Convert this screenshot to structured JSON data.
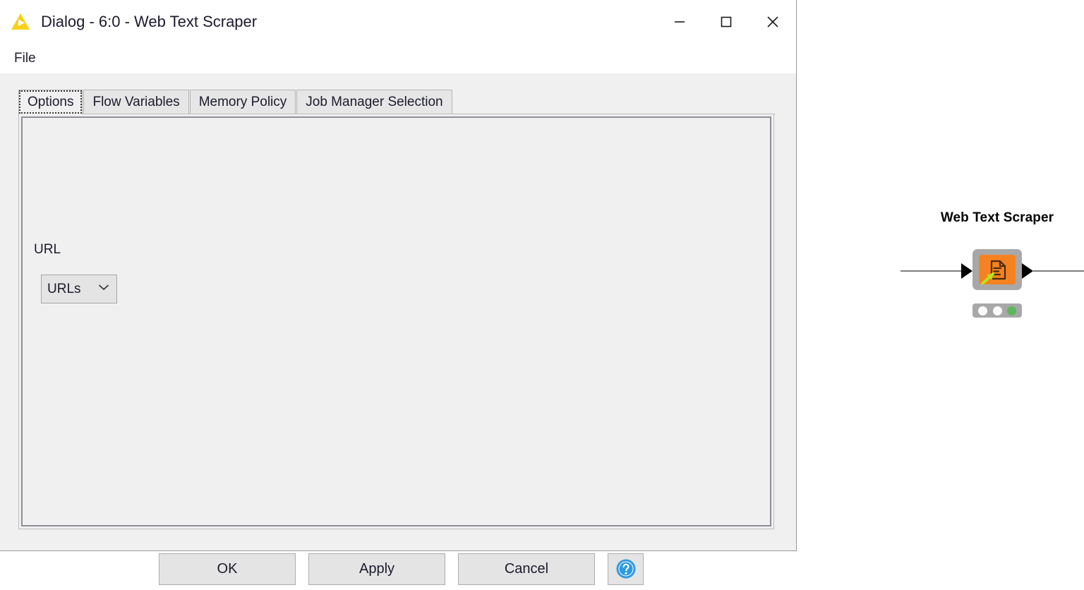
{
  "window": {
    "title": "Dialog - 6:0 - Web Text Scraper",
    "icon": "knime-triangle-icon",
    "controls": {
      "minimize": "minimize-icon",
      "maximize": "maximize-icon",
      "close": "close-icon"
    }
  },
  "menubar": {
    "items": [
      {
        "label": "File"
      }
    ]
  },
  "tabs": [
    {
      "label": "Options",
      "selected": true
    },
    {
      "label": "Flow Variables",
      "selected": false
    },
    {
      "label": "Memory Policy",
      "selected": false
    },
    {
      "label": "Job Manager Selection",
      "selected": false
    }
  ],
  "options": {
    "url_label": "URL",
    "url_select": {
      "value": "URLs",
      "options": [
        "URLs"
      ],
      "chevron": "chevron-down-icon"
    }
  },
  "buttons": {
    "ok": "OK",
    "apply": "Apply",
    "cancel": "Cancel",
    "help": "help-icon"
  },
  "canvas": {
    "node": {
      "label": "Web Text Scraper",
      "icon": "document-scrape-icon",
      "status": [
        "idle",
        "idle",
        "executed"
      ],
      "ports": {
        "input": "input-port",
        "output": "output-port"
      }
    }
  },
  "colors": {
    "accent_orange": "#f58220",
    "node_gray": "#a8a8a8",
    "status_green": "#5cb85c",
    "title_yellow": "#f7d117",
    "help_blue": "#2f9ae0",
    "dialog_bg": "#f0f0f0"
  }
}
